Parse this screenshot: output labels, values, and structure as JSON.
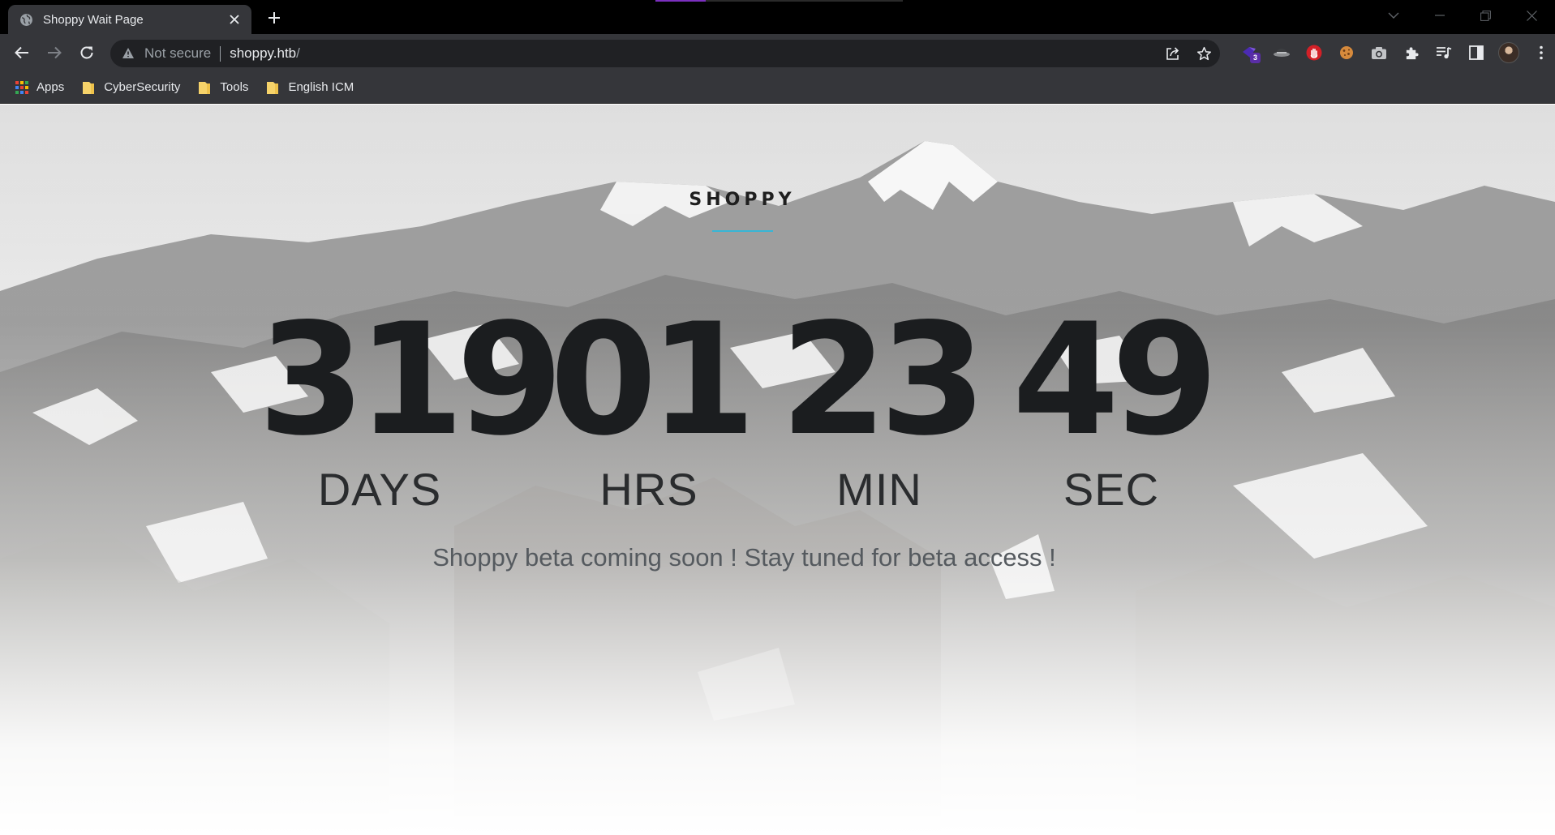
{
  "browser": {
    "tab_title": "Shoppy Wait Page",
    "security_label": "Not secure",
    "url_host": "shoppy.htb",
    "url_path": "/",
    "extension_badge": "3",
    "bookmarks": [
      {
        "label": "Apps",
        "icon": "apps-grid-icon"
      },
      {
        "label": "CyberSecurity",
        "icon": "folder-icon"
      },
      {
        "label": "Tools",
        "icon": "folder-icon"
      },
      {
        "label": "English ICM",
        "icon": "folder-icon"
      }
    ]
  },
  "page": {
    "brand": "SHOPPY",
    "countdown": [
      {
        "value": "319",
        "label": "DAYS"
      },
      {
        "value": "01",
        "label": "HRS"
      },
      {
        "value": "23",
        "label": "MIN"
      },
      {
        "value": "49",
        "label": "SEC"
      }
    ],
    "tagline": "Shoppy beta coming soon ! Stay tuned for beta access !"
  },
  "colors": {
    "chrome_dark": "#35363a",
    "accent_underline": "#38b6d6",
    "digit_color": "#1b1d1f"
  }
}
